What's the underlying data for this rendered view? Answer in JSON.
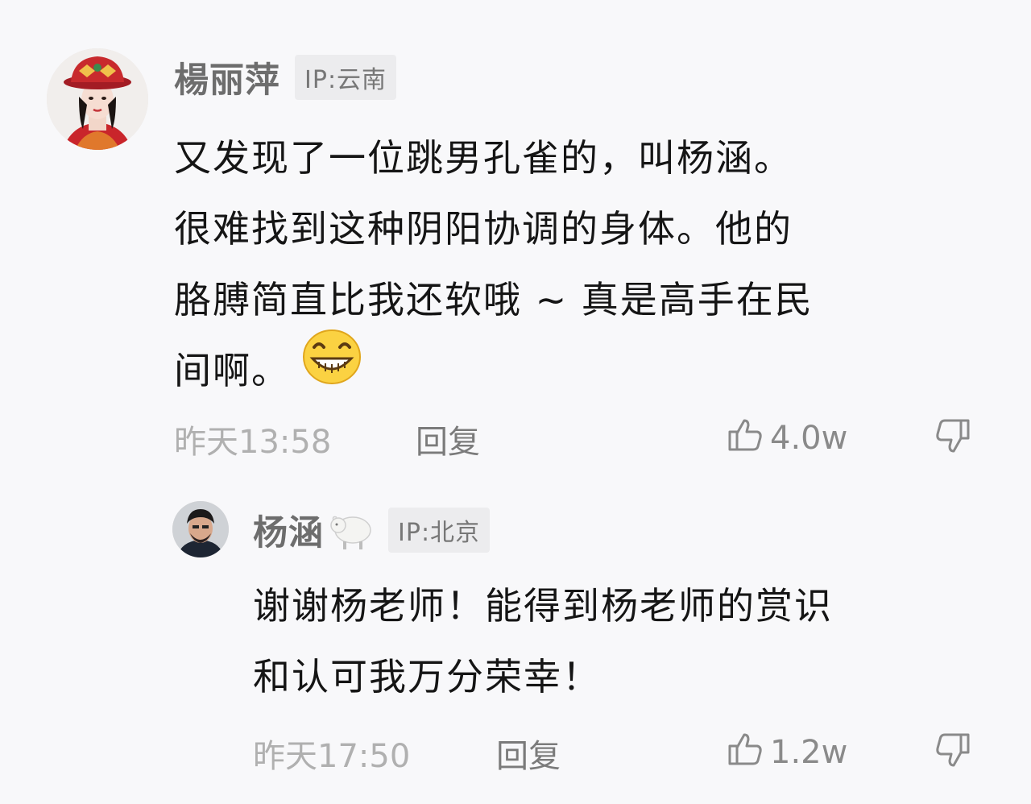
{
  "comments": [
    {
      "username": "楊丽萍",
      "ip": "IP:云南",
      "text_lines": [
        "又发现了一位跳男孔雀的，叫杨涵。",
        "很难找到这种阴阳协调的身体。他的",
        "胳膊简直比我还软哦 ~ 真是高手在民",
        "间啊。"
      ],
      "emoji": "grinning-face-emoji",
      "time": "昨天13:58",
      "reply_label": "回复",
      "likes": "4.0w",
      "like_icon": "thumb-up-icon",
      "dislike_icon": "thumb-down-icon"
    },
    {
      "username": "杨涵",
      "badge_icon": "sheep-icon",
      "ip": "IP:北京",
      "text_lines": [
        "谢谢杨老师！能得到杨老师的赏识",
        "和认可我万分荣幸！"
      ],
      "time": "昨天17:50",
      "reply_label": "回复",
      "likes": "1.2w",
      "like_icon": "thumb-up-icon",
      "dislike_icon": "thumb-down-icon"
    }
  ],
  "colors": {
    "background": "#f8f8fa",
    "username": "#6d6d6d",
    "meta": "#b0b0b0",
    "ip_badge_bg": "#ececee"
  }
}
